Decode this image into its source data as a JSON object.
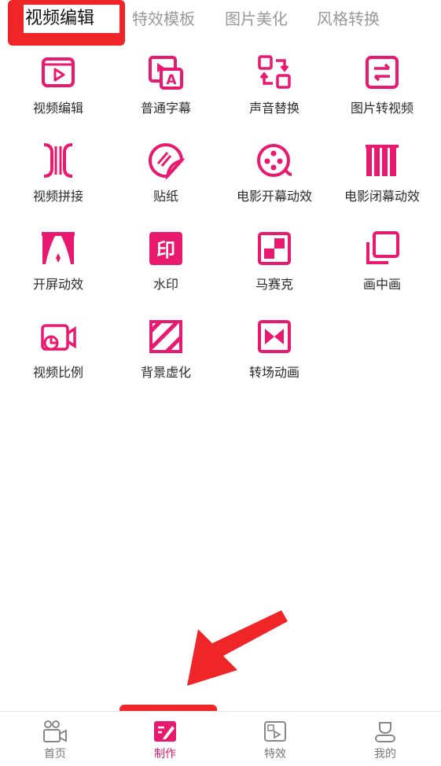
{
  "tabs": [
    {
      "label": "视频编辑",
      "active": true
    },
    {
      "label": "特效模板",
      "active": false
    },
    {
      "label": "图片美化",
      "active": false
    },
    {
      "label": "风格转换",
      "active": false
    }
  ],
  "tools": [
    {
      "label": "视频编辑",
      "icon": "video-edit-icon"
    },
    {
      "label": "普通字幕",
      "icon": "subtitle-icon"
    },
    {
      "label": "声音替换",
      "icon": "sound-replace-icon"
    },
    {
      "label": "图片转视频",
      "icon": "image-to-video-icon"
    },
    {
      "label": "视频拼接",
      "icon": "video-splice-icon"
    },
    {
      "label": "贴纸",
      "icon": "sticker-icon"
    },
    {
      "label": "电影开幕动效",
      "icon": "film-reel-icon"
    },
    {
      "label": "电影闭幕动效",
      "icon": "curtain-close-icon"
    },
    {
      "label": "开屏动效",
      "icon": "curtain-open-icon"
    },
    {
      "label": "水印",
      "icon": "watermark-stamp-icon"
    },
    {
      "label": "马赛克",
      "icon": "mosaic-icon"
    },
    {
      "label": "画中画",
      "icon": "picture-in-picture-icon"
    },
    {
      "label": "视频比例",
      "icon": "video-ratio-icon"
    },
    {
      "label": "背景虚化",
      "icon": "background-blur-icon"
    },
    {
      "label": "转场动画",
      "icon": "transition-icon"
    }
  ],
  "nav": [
    {
      "label": "首页",
      "icon": "home-camera-icon",
      "active": false
    },
    {
      "label": "制作",
      "icon": "create-edit-icon",
      "active": true
    },
    {
      "label": "特效",
      "icon": "effects-icon",
      "active": false
    },
    {
      "label": "我的",
      "icon": "profile-icon",
      "active": false
    }
  ],
  "colors": {
    "accent": "#e8196e",
    "highlight": "#f02528"
  }
}
